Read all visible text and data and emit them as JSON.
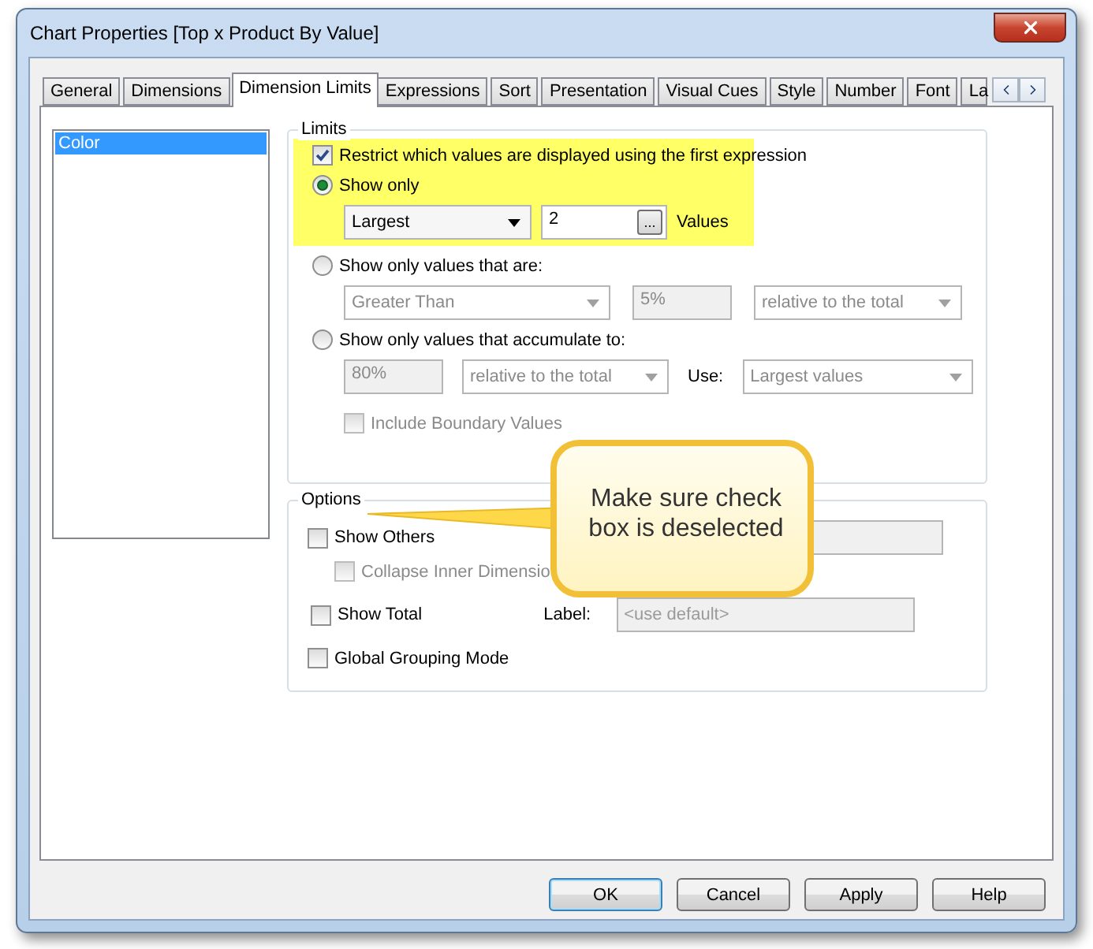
{
  "window": {
    "title": "Chart Properties [Top x Product By Value]"
  },
  "tabs": [
    {
      "label": "General",
      "selected": false
    },
    {
      "label": "Dimensions",
      "selected": false
    },
    {
      "label": "Dimension Limits",
      "selected": true
    },
    {
      "label": "Expressions",
      "selected": false
    },
    {
      "label": "Sort",
      "selected": false
    },
    {
      "label": "Presentation",
      "selected": false
    },
    {
      "label": "Visual Cues",
      "selected": false
    },
    {
      "label": "Style",
      "selected": false
    },
    {
      "label": "Number",
      "selected": false
    },
    {
      "label": "Font",
      "selected": false
    },
    {
      "label": "La",
      "selected": false
    }
  ],
  "dimension_list": {
    "items": [
      {
        "label": "Color",
        "selected": true
      }
    ]
  },
  "limits": {
    "title": "Limits",
    "highlight": true,
    "restrict": {
      "label": "Restrict which values are displayed using the first expression",
      "checked": true
    },
    "choices": [
      {
        "kind": "show_only",
        "label": "Show only",
        "selected": true,
        "mode": "Largest",
        "count": "2",
        "more": "...",
        "unit": "Values"
      },
      {
        "kind": "values_that_are",
        "label": "Show only values that are:",
        "selected": false,
        "comparison": "Greater Than",
        "value": "5%",
        "relative": "relative to the total"
      },
      {
        "kind": "accumulate",
        "label": "Show only values that accumulate to:",
        "selected": false,
        "value": "80%",
        "relative": "relative to the total",
        "use_label": "Use:",
        "use": "Largest values"
      }
    ],
    "include_boundary": {
      "label": "Include Boundary Values",
      "checked": false,
      "disabled": true
    }
  },
  "options": {
    "title": "Options",
    "show_others": {
      "label": "Show Others",
      "checked": false
    },
    "collapse": {
      "label": "Collapse Inner Dimensio",
      "checked": false,
      "disabled": true
    },
    "show_total": {
      "label": "Show Total",
      "checked": false
    },
    "total_label": {
      "label": "Label:",
      "placeholder": "<use default>"
    },
    "global_grouping": {
      "label": "Global Grouping Mode",
      "checked": false
    }
  },
  "callout": {
    "text": "Make sure check box is deselected"
  },
  "buttons": [
    {
      "label": "OK",
      "default": true
    },
    {
      "label": "Cancel",
      "default": false
    },
    {
      "label": "Apply",
      "default": false
    },
    {
      "label": "Help",
      "default": false
    }
  ]
}
